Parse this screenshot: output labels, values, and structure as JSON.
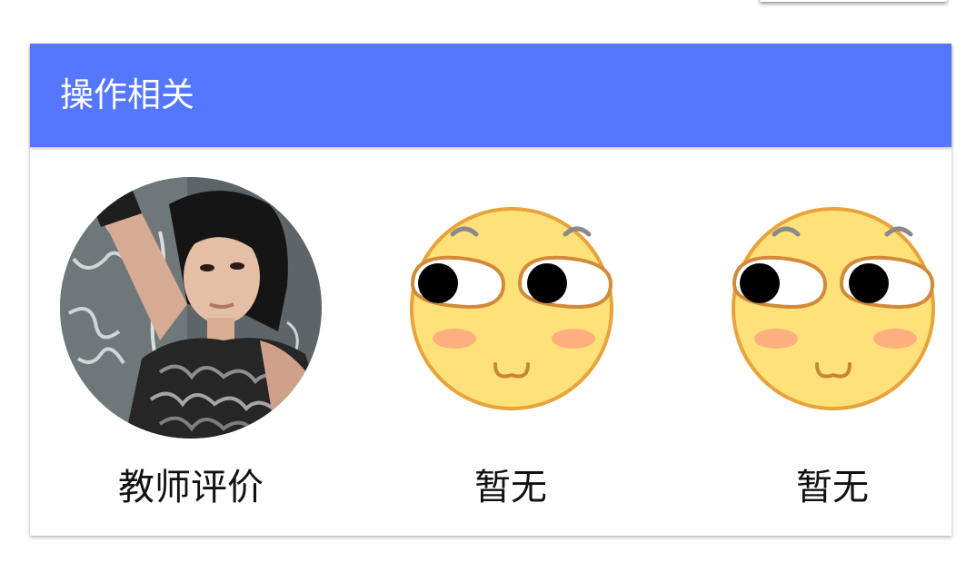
{
  "colors": {
    "header_bg": "#5477FE",
    "header_text": "#FFFFFF",
    "card_bg": "#FFFFFF",
    "caption_text": "#111111",
    "emoji_face": "#FFE17A",
    "emoji_outline": "#E8A33A",
    "emoji_blush": "#FDB07E"
  },
  "section": {
    "title": "操作相关"
  },
  "items": [
    {
      "label": "教师评价",
      "icon": "teacher-avatar-photo"
    },
    {
      "label": "暂无",
      "icon": "shy-face-emoji-icon"
    },
    {
      "label": "暂无",
      "icon": "shy-face-emoji-icon"
    }
  ]
}
